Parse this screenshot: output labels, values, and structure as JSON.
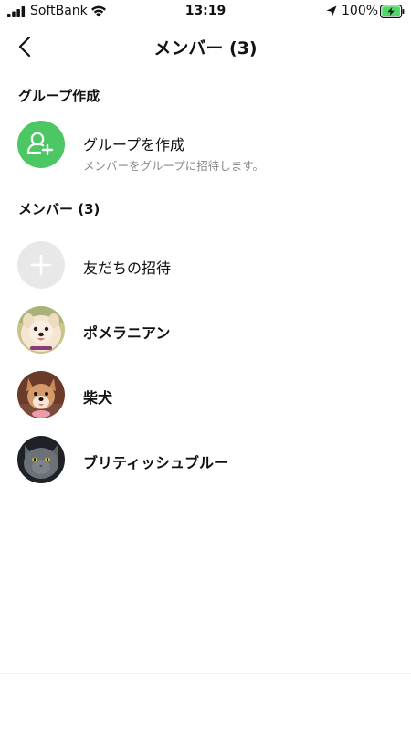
{
  "status_bar": {
    "carrier": "SoftBank",
    "time": "13:19",
    "battery_percent": "100%",
    "icons": [
      "signal-icon",
      "wifi-icon",
      "location-arrow-icon",
      "battery-charging-icon"
    ]
  },
  "nav": {
    "back_icon": "chevron-left-icon",
    "title": "メンバー (3)"
  },
  "group_section": {
    "header": "グループ作成",
    "create_group": {
      "icon": "add-group-icon",
      "title": "グループを作成",
      "subtitle": "メンバーをグループに招待します。"
    }
  },
  "member_section": {
    "header": "メンバー (3)",
    "invite": {
      "icon": "plus-icon",
      "label": "友だちの招待"
    },
    "members": [
      {
        "name": "ポメラニアン",
        "avatar": "pomeranian-avatar"
      },
      {
        "name": "柴犬",
        "avatar": "shiba-avatar"
      },
      {
        "name": "ブリティッシュブルー",
        "avatar": "british-blue-cat-avatar"
      }
    ]
  },
  "colors": {
    "accent_green": "#4cc764",
    "invite_gray": "#e8e8e8",
    "subtitle_gray": "#8a8a8a",
    "battery_green": "#4cd964"
  }
}
